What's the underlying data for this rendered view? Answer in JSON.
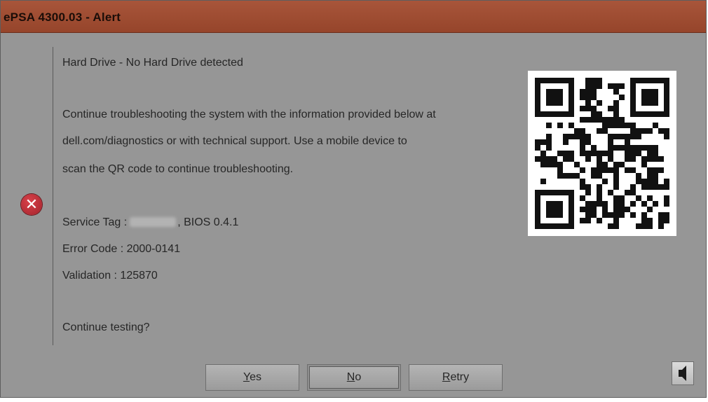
{
  "window": {
    "title": "ePSA 4300.03 - Alert"
  },
  "message": {
    "headline": "Hard Drive - No Hard Drive detected",
    "body_line1": "Continue troubleshooting the system with the information provided below at",
    "body_line2": "dell.com/diagnostics or with technical support.  Use a mobile device to",
    "body_line3": "scan the QR code to continue troubleshooting.",
    "service_tag_label": "Service Tag :",
    "service_tag_suffix": ", BIOS 0.4.1",
    "error_code": "Error Code : 2000-0141",
    "validation": "Validation : 125870",
    "prompt": "Continue testing?"
  },
  "buttons": {
    "yes_underlined": "Y",
    "yes_rest": "es",
    "no_underlined": "N",
    "no_rest": "o",
    "retry_underlined": "R",
    "retry_rest": "etry"
  },
  "icons": {
    "error": "error-circle-x-icon",
    "qr": "qr-code",
    "speaker": "speaker-icon"
  },
  "colors": {
    "titlebar": "#a04d33",
    "background": "#969696",
    "error_icon": "#c0303a"
  }
}
